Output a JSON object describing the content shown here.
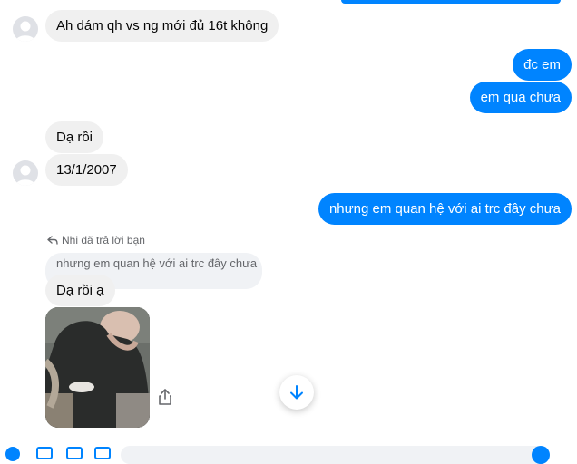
{
  "messages": {
    "m1": "Ah dám qh vs ng mới đủ 16t không",
    "m2": "đc em",
    "m3": "em qua chưa",
    "m4": "Dạ rồi",
    "m5": "13/1/2007",
    "m6": "nhưng em quan hệ với ai trc đây chưa",
    "reply_note": "Nhi đã trả lời bạn",
    "quoted_text": "nhưng em quan hệ với ai trc đây chưa",
    "m7": "Dạ rồi ạ"
  },
  "colors": {
    "outgoing_bubble": "#0084ff",
    "incoming_bubble": "#f0f0f0",
    "accent": "#0084ff"
  },
  "icons": [
    "avatar-placeholder",
    "reply-arrow-icon",
    "share-icon",
    "arrow-down-icon"
  ]
}
